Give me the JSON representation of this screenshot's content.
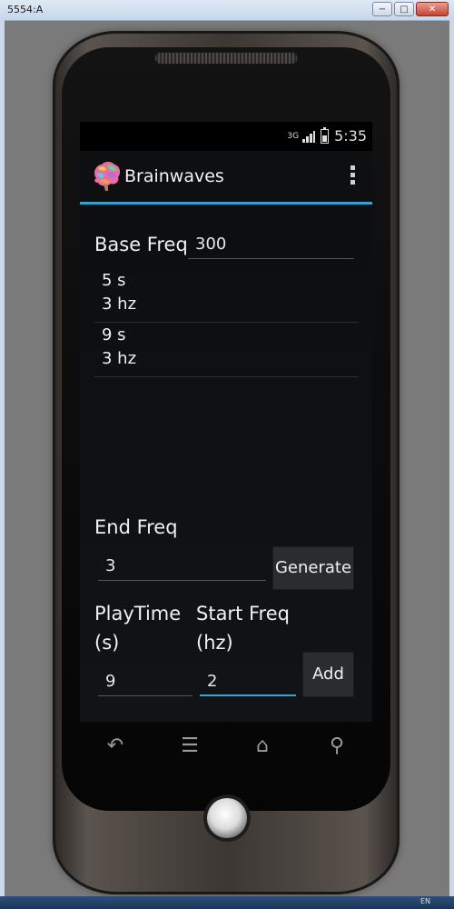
{
  "window": {
    "title": "5554:A",
    "controls": {
      "minimize": "−",
      "maximize": "□",
      "close": "✕"
    }
  },
  "taskbar": {
    "language": "EN"
  },
  "status_bar": {
    "network": "3G",
    "time": "5:35"
  },
  "action_bar": {
    "title": "Brainwaves",
    "accent_color": "#33a4cf"
  },
  "form": {
    "base_freq_label": "Base Freq",
    "base_freq_value": "300",
    "end_freq_label": "End Freq",
    "end_freq_value": "3",
    "generate_label": "Generate",
    "playtime_label_line1": "PlayTime",
    "playtime_label_line2": "(s)",
    "playtime_value": "9",
    "start_freq_label_line1": "Start Freq",
    "start_freq_label_line2": "(hz)",
    "start_freq_value": "2",
    "add_label": "Add"
  },
  "segments": [
    {
      "duration": "5 s",
      "freq": "3 hz"
    },
    {
      "duration": "9 s",
      "freq": "3 hz"
    }
  ],
  "nav": {
    "back_icon": "↶",
    "menu_icon": "☰",
    "home_icon": "⌂",
    "search_icon": "⚲"
  }
}
